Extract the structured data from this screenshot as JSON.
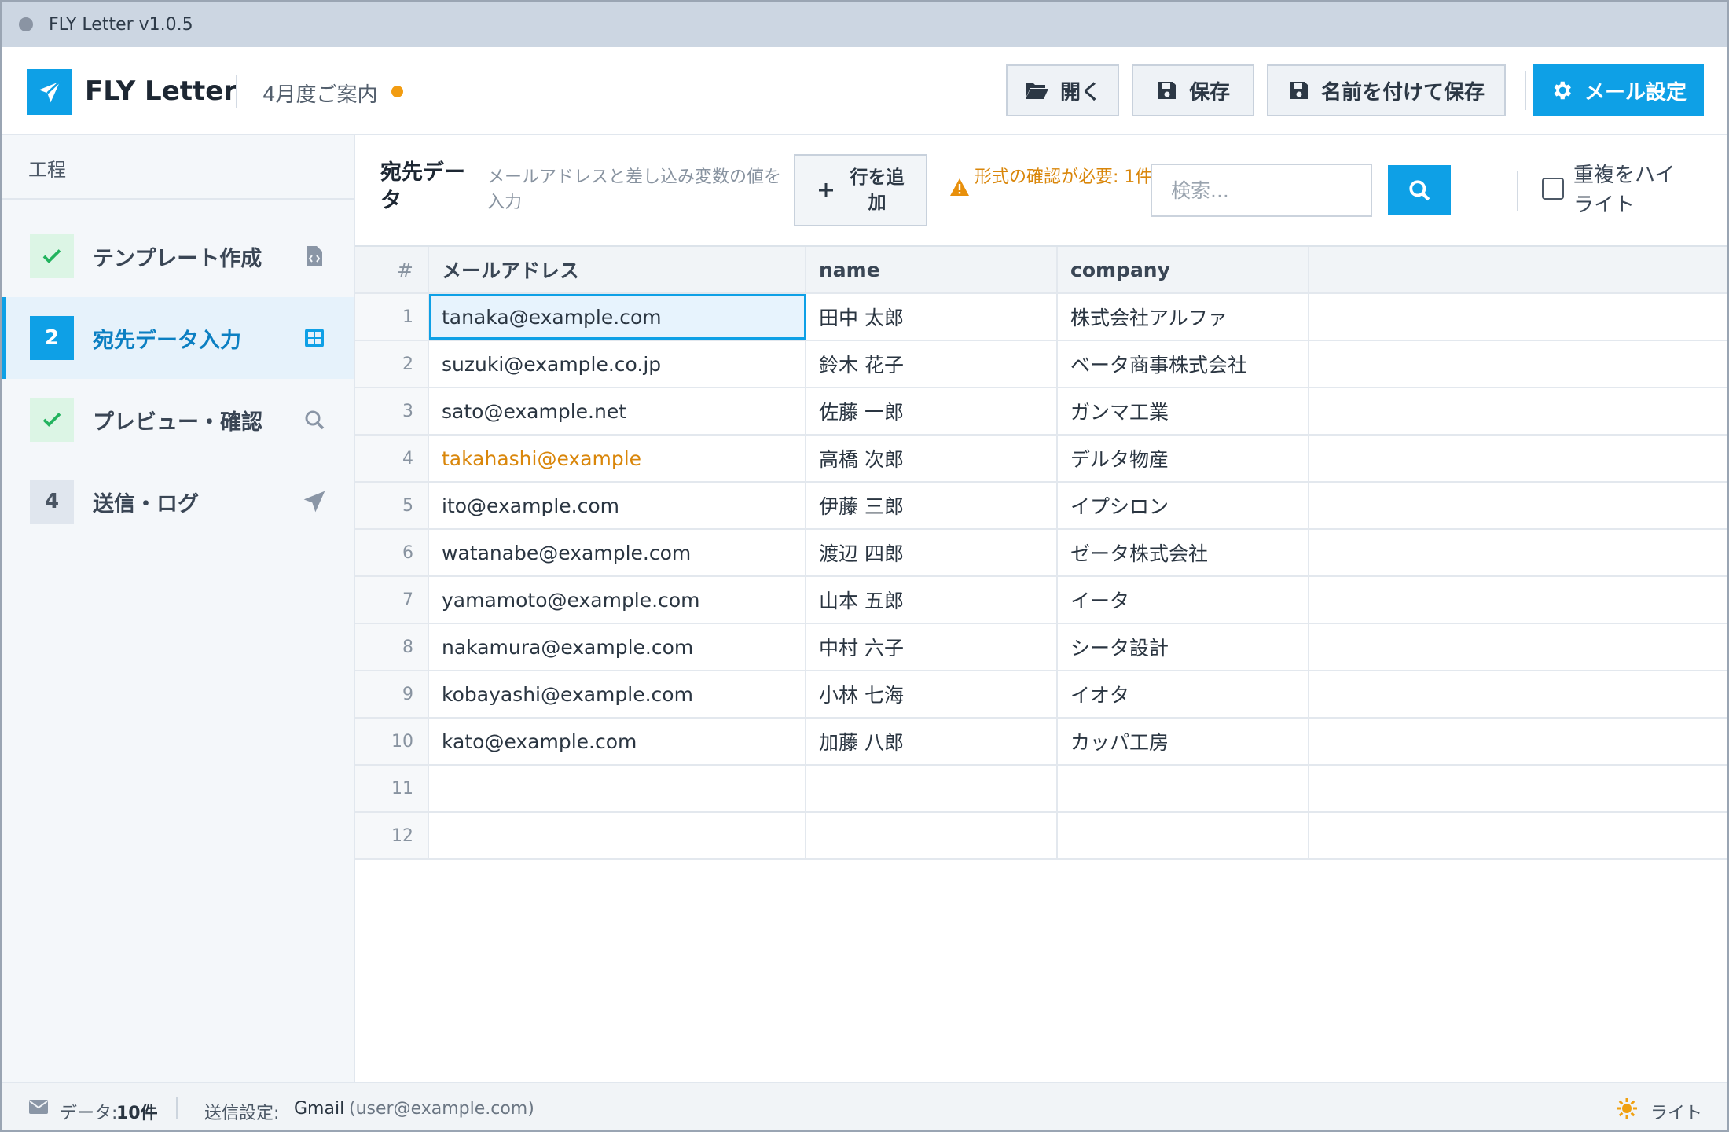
{
  "window": {
    "title": "FLY Letter v1.0.5"
  },
  "header": {
    "app_name": "FLY Letter",
    "document_name": "4月度ご案内",
    "buttons": {
      "open": "開く",
      "save": "保存",
      "save_as": "名前を付けて保存",
      "mail_settings": "メール設定"
    }
  },
  "sidebar": {
    "title": "工程",
    "steps": [
      {
        "badge": "",
        "label": "テンプレート作成",
        "status": "done",
        "icon": "file-code-icon"
      },
      {
        "badge": "2",
        "label": "宛先データ入力",
        "status": "active",
        "icon": "grid-icon"
      },
      {
        "badge": "",
        "label": "プレビュー・確認",
        "status": "done",
        "icon": "search-icon"
      },
      {
        "badge": "4",
        "label": "送信・ログ",
        "status": "pending",
        "icon": "send-icon"
      }
    ]
  },
  "toolbar": {
    "title": "宛先データ",
    "description": "メールアドレスと差し込み変数の値を入力",
    "add_row": "行を追加",
    "warning": "形式の確認が必要: 1件",
    "search_placeholder": "検索...",
    "highlight_duplicates": "重複をハイライト"
  },
  "grid": {
    "columns": {
      "num": "#",
      "email": "メールアドレス",
      "name": "name",
      "company": "company"
    },
    "rows": [
      {
        "num": "1",
        "email": "tanaka@example.com",
        "name": "田中 太郎",
        "company": "株式会社アルファ"
      },
      {
        "num": "2",
        "email": "suzuki@example.co.jp",
        "name": "鈴木 花子",
        "company": "ベータ商事株式会社"
      },
      {
        "num": "3",
        "email": "sato@example.net",
        "name": "佐藤 一郎",
        "company": "ガンマ工業"
      },
      {
        "num": "4",
        "email": "takahashi@example",
        "name": "高橋 次郎",
        "company": "デルタ物産"
      },
      {
        "num": "5",
        "email": "ito@example.com",
        "name": "伊藤 三郎",
        "company": "イプシロン"
      },
      {
        "num": "6",
        "email": "watanabe@example.com",
        "name": "渡辺 四郎",
        "company": "ゼータ株式会社"
      },
      {
        "num": "7",
        "email": "yamamoto@example.com",
        "name": "山本 五郎",
        "company": "イータ"
      },
      {
        "num": "8",
        "email": "nakamura@example.com",
        "name": "中村 六子",
        "company": "シータ設計"
      },
      {
        "num": "9",
        "email": "kobayashi@example.com",
        "name": "小林 七海",
        "company": "イオタ"
      },
      {
        "num": "10",
        "email": "kato@example.com",
        "name": "加藤 八郎",
        "company": "カッパ工房"
      },
      {
        "num": "11",
        "email": "",
        "name": "",
        "company": ""
      },
      {
        "num": "12",
        "email": "",
        "name": "",
        "company": ""
      }
    ]
  },
  "statusbar": {
    "data_label": "データ:",
    "data_value": "10件",
    "send_label": "送信設定:",
    "send_service": "Gmail",
    "send_account": "(user@example.com)",
    "theme": "ライト"
  },
  "colors": {
    "accent": "#0ea0e6",
    "warning": "#d9860a",
    "done": "#22b35e",
    "unsaved": "#f29c11"
  }
}
